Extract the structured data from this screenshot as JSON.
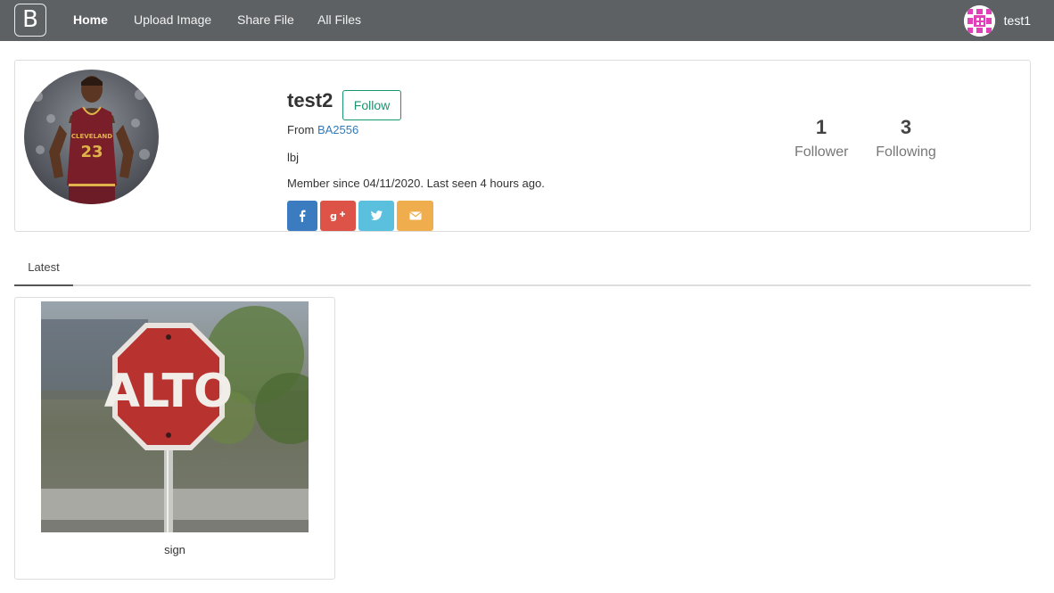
{
  "nav": {
    "brand": "B",
    "links": [
      "Home",
      "Upload Image",
      "Share File",
      "All Files"
    ],
    "user": "test1"
  },
  "profile": {
    "username": "test2",
    "follow_label": "Follow",
    "from_prefix": "From",
    "from_link": "BA2556",
    "bio": "lbj",
    "member_since": "Member since 04/11/2020. Last seen 4 hours ago.",
    "social_icons": [
      "facebook-icon",
      "google-plus-icon",
      "twitter-icon",
      "envelope-icon"
    ],
    "stats": {
      "followers": {
        "value": "1",
        "label": "Follower"
      },
      "following": {
        "value": "3",
        "label": "Following"
      }
    }
  },
  "tabs": [
    "Latest"
  ],
  "files": [
    {
      "caption": "sign",
      "image_text": "ALTO"
    }
  ],
  "colors": {
    "navbar": "#5e6164",
    "follow": "#1a936f",
    "link": "#337ab7",
    "facebook": "#3b7bbf",
    "google_plus": "#dd5347",
    "twitter": "#5bc0de",
    "email": "#f0ad4e"
  }
}
